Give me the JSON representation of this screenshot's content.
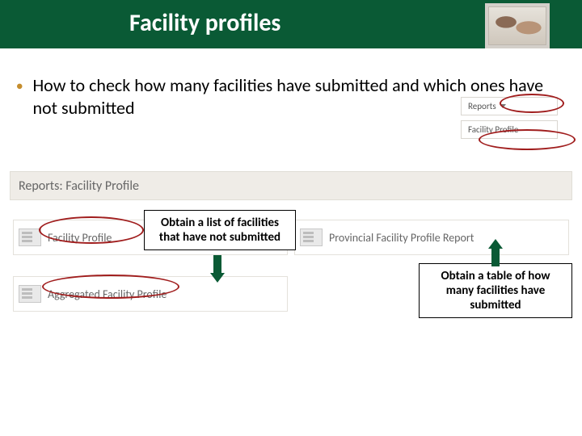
{
  "header": {
    "title": "Facility profiles"
  },
  "bullet": {
    "text": "How to check how many facilities have submitted and which ones have not submitted"
  },
  "menu": {
    "reports_label": "Reports",
    "facility_profile_label": "Facility Profile"
  },
  "section_bar": {
    "title": "Reports: Facility Profile"
  },
  "cards": {
    "facility_profile": "Facility Profile",
    "provincial_facility_profile_report": "Provincial Facility Profile Report",
    "aggregated_facility_profile": "Aggregated Facility Profile"
  },
  "callouts": {
    "not_submitted": "Obtain a list of facilities that have not submitted",
    "submitted_count": "Obtain a table of how many facilities have submitted"
  },
  "colors": {
    "header_green": "#0a5a35",
    "bullet_accent": "#c58d2d",
    "annotation_red": "#a01d1d"
  }
}
